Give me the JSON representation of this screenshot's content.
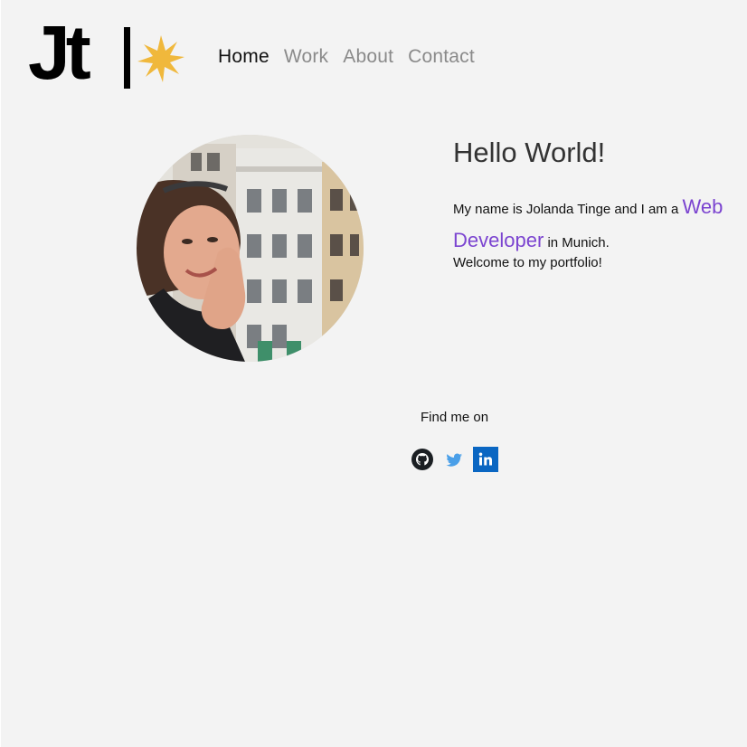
{
  "header": {
    "logo_text": "Jt",
    "nav": [
      {
        "label": "Home",
        "active": true
      },
      {
        "label": "Work",
        "active": false
      },
      {
        "label": "About",
        "active": false
      },
      {
        "label": "Contact",
        "active": false
      }
    ]
  },
  "intro": {
    "greeting": "Hello World!",
    "name_prefix": "My name is Jolanda Tinge and I am a ",
    "role": "Web Developer",
    "location_suffix": " in Munich.",
    "welcome": "Welcome to my portfolio!"
  },
  "social": {
    "label": "Find me on",
    "links": [
      {
        "name": "github-icon",
        "color": "#1b1f23"
      },
      {
        "name": "twitter-icon",
        "color": "#4a9fe8"
      },
      {
        "name": "linkedin-icon",
        "color": "#0a66c2"
      }
    ]
  },
  "colors": {
    "background": "#f3f3f3",
    "accent": "#7b44d0",
    "logo_sun": "#f0b83c",
    "nav_inactive": "#8a8a8a"
  }
}
